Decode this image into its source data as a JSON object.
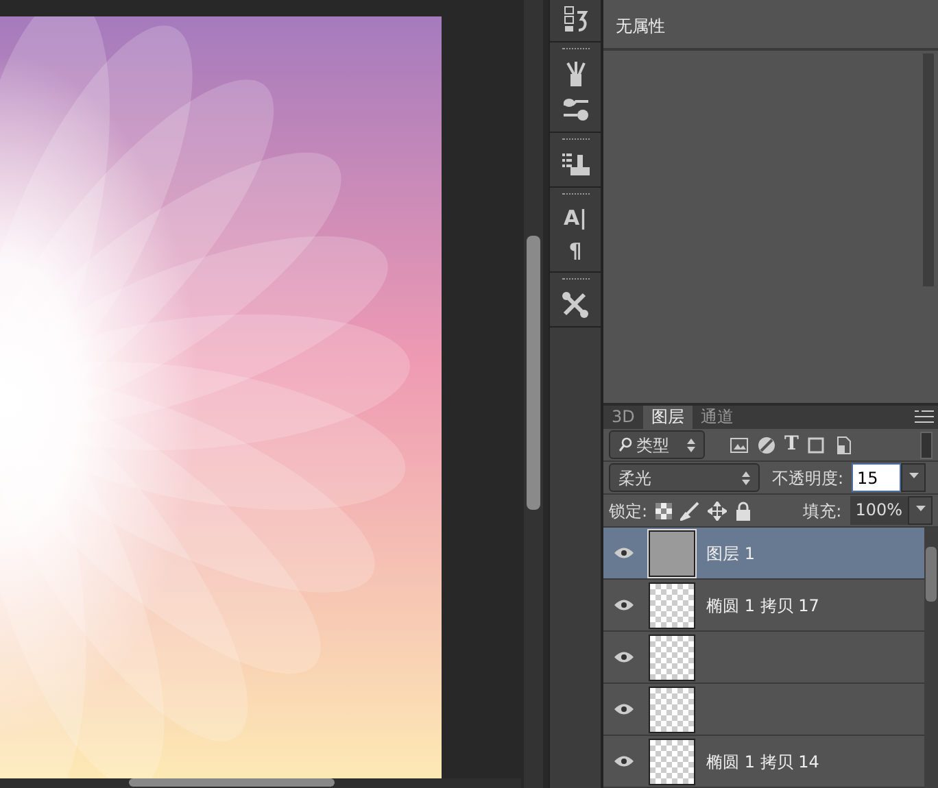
{
  "tool_strip": {
    "type_glyphs": [
      "A|",
      "¶"
    ]
  },
  "properties": {
    "title": "无属性"
  },
  "layers_panel": {
    "tabs": [
      {
        "label": "3D",
        "selected": false
      },
      {
        "label": "图层",
        "selected": true
      },
      {
        "label": "通道",
        "selected": false
      }
    ],
    "filter": {
      "value": "类型",
      "type_glyph": "T"
    },
    "blend_mode": {
      "value": "柔光"
    },
    "opacity": {
      "label": "不透明度:",
      "value": "15"
    },
    "lock_label": "锁定:",
    "fill": {
      "label": "填充:",
      "value": "100%"
    },
    "layers": [
      {
        "name": "图层 1",
        "selected": true,
        "visible": true,
        "kind": "pixel"
      },
      {
        "name": "椭圆 1 拷贝 17",
        "selected": false,
        "visible": true,
        "kind": "shape"
      },
      {
        "selected": false,
        "visible": true,
        "kind": "shape"
      },
      {
        "selected": false,
        "visible": true,
        "kind": "shape"
      },
      {
        "name": "椭圆 1 拷贝 14",
        "selected": false,
        "visible": true,
        "kind": "shape"
      }
    ]
  }
}
